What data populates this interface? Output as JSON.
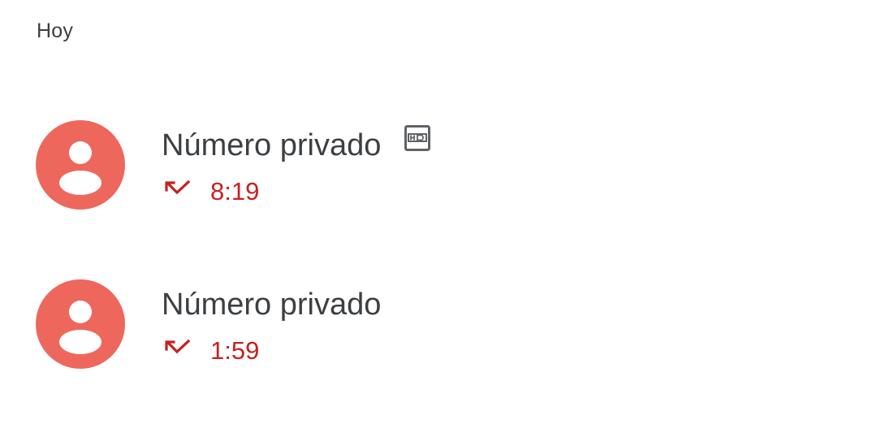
{
  "section": {
    "header": "Hoy"
  },
  "calls": [
    {
      "name": "Número privado",
      "time": "8:19",
      "status_icon": "missed-call-icon",
      "hd_icon": "hd-icon",
      "has_hd": true
    },
    {
      "name": "Número privado",
      "time": "1:59",
      "status_icon": "missed-call-icon",
      "has_hd": false
    }
  ],
  "colors": {
    "avatar_bg": "#ee675c",
    "missed": "#c5221f",
    "text_primary": "#3c4043",
    "hd_icon": "#5f6368"
  }
}
